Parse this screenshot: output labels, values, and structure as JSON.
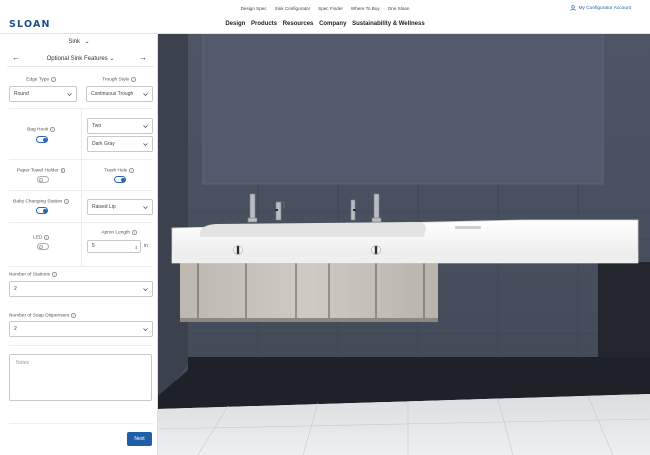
{
  "util_bar": {
    "links": [
      "Design Spec",
      "Sink Configurator",
      "Spec Finder",
      "Where To Buy",
      "One Sloan"
    ],
    "account": "My Configurator Account"
  },
  "header": {
    "logo": "SLOAN",
    "nav": [
      "Design",
      "Products",
      "Resources",
      "Company",
      "Sustainability & Wellness"
    ]
  },
  "panel": {
    "sink_select": "Sink",
    "section_title": "Optional Sink Features",
    "edge_type": {
      "label": "Edge Type",
      "value": "Round"
    },
    "trough_style": {
      "label": "Trough Style",
      "value": "Continuous Trough"
    },
    "bag_hook": {
      "label": "Bag Hook",
      "enabled": true,
      "quantity": "Two",
      "color": "Dark Gray"
    },
    "paper_towel_holder": {
      "label": "Paper Towel Holder",
      "enabled": false
    },
    "trash_hole": {
      "label": "Trash Hole",
      "enabled": true
    },
    "baby_changing_station": {
      "label": "Baby Changing Station",
      "enabled": true,
      "option": "Raised Lip"
    },
    "led": {
      "label": "LED",
      "enabled": false
    },
    "apron_length": {
      "label": "Apron Length",
      "value": "5",
      "unit": "in"
    },
    "number_of_stations": {
      "label": "Number of Stations",
      "value": "2"
    },
    "number_of_soap_dispensers": {
      "label": "Number of Soap Dispensers",
      "value": "2"
    },
    "notes_placeholder": "Notes",
    "next_label": "Next"
  },
  "colors": {
    "brand_blue": "#1f5fa6",
    "wall": "#4c5464",
    "floor": "#e4e5e7",
    "sink": "#f7f7f7",
    "cabinet": "#c9c3bc"
  },
  "icons": [
    "user-icon",
    "chevron-down-icon",
    "arrow-left-icon",
    "arrow-right-icon",
    "info-icon",
    "spinner-icon"
  ]
}
